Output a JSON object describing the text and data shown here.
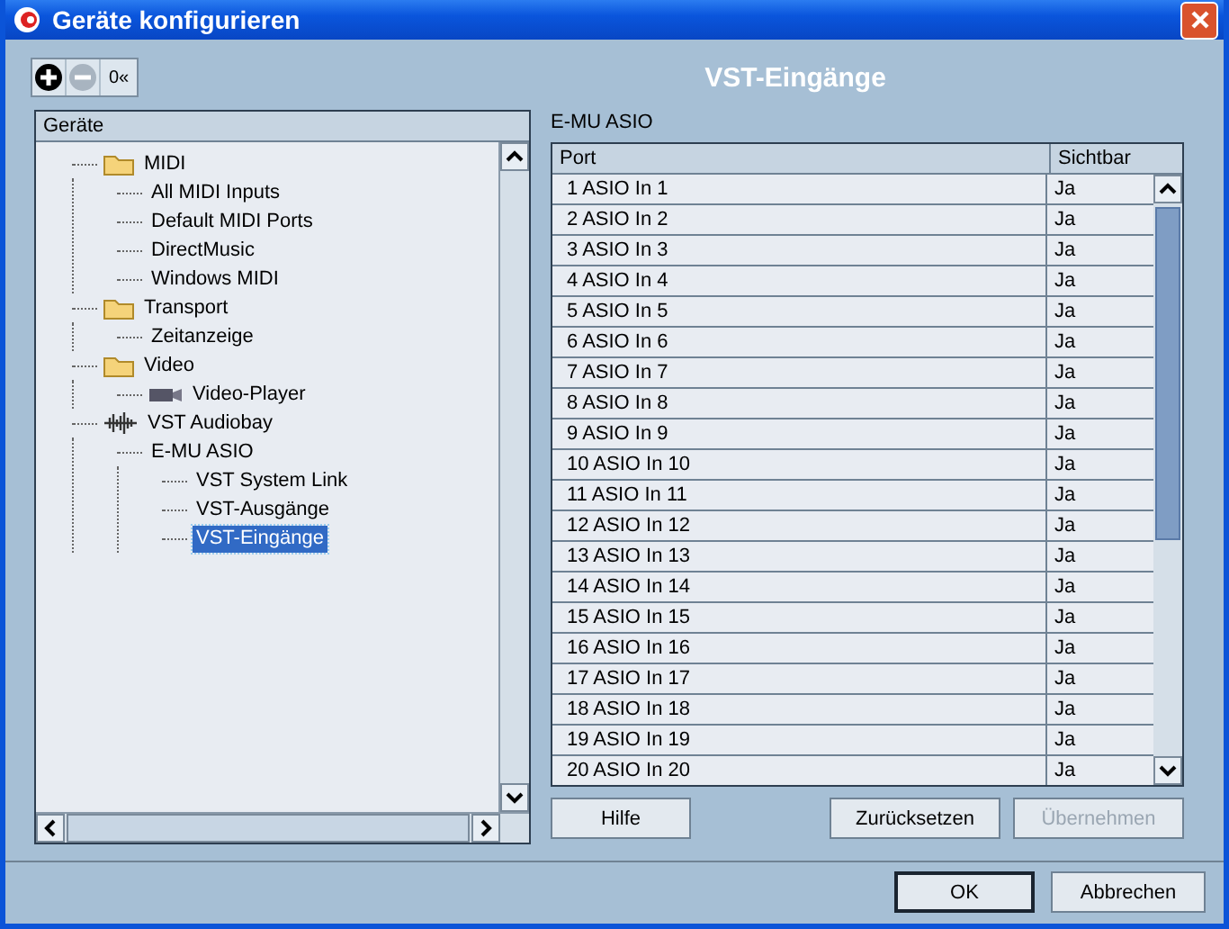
{
  "window": {
    "title": "Geräte konfigurieren"
  },
  "toolbar": [
    {
      "kind": "add",
      "disabled": false
    },
    {
      "kind": "remove",
      "disabled": true
    },
    {
      "kind": "text",
      "label": "0«",
      "disabled": false
    }
  ],
  "heading": "VST-Eingänge",
  "tree": {
    "header": "Geräte",
    "items": [
      {
        "label": "MIDI",
        "kind": "folder",
        "selected": false,
        "children": [
          {
            "label": "All MIDI Inputs",
            "selected": false
          },
          {
            "label": "Default MIDI Ports",
            "selected": false
          },
          {
            "label": "DirectMusic",
            "selected": false
          },
          {
            "label": "Windows MIDI",
            "selected": false
          }
        ]
      },
      {
        "label": "Transport",
        "kind": "folder",
        "selected": false,
        "children": [
          {
            "label": "Zeitanzeige",
            "selected": false
          }
        ]
      },
      {
        "label": "Video",
        "kind": "folder",
        "selected": false,
        "children": [
          {
            "label": "Video-Player",
            "kind": "video",
            "selected": false
          }
        ]
      },
      {
        "label": "VST Audiobay",
        "kind": "audio",
        "selected": false,
        "children": [
          {
            "label": "E-MU ASIO",
            "selected": false,
            "children": [
              {
                "label": "VST System Link",
                "selected": false
              },
              {
                "label": "VST-Ausgänge",
                "selected": false
              },
              {
                "label": "VST-Eingänge",
                "selected": true
              }
            ]
          }
        ]
      }
    ]
  },
  "device_label": "E-MU ASIO",
  "table": {
    "columns": [
      "Port",
      "Sichtbar"
    ],
    "rows": [
      [
        "1 ASIO In 1",
        "Ja"
      ],
      [
        "2 ASIO In 2",
        "Ja"
      ],
      [
        "3 ASIO In 3",
        "Ja"
      ],
      [
        "4 ASIO In 4",
        "Ja"
      ],
      [
        "5 ASIO In 5",
        "Ja"
      ],
      [
        "6 ASIO In 6",
        "Ja"
      ],
      [
        "7 ASIO In 7",
        "Ja"
      ],
      [
        "8 ASIO In 8",
        "Ja"
      ],
      [
        "9 ASIO In 9",
        "Ja"
      ],
      [
        "10 ASIO In 10",
        "Ja"
      ],
      [
        "11 ASIO In 11",
        "Ja"
      ],
      [
        "12 ASIO In 12",
        "Ja"
      ],
      [
        "13 ASIO In 13",
        "Ja"
      ],
      [
        "14 ASIO In 14",
        "Ja"
      ],
      [
        "15 ASIO In 15",
        "Ja"
      ],
      [
        "16 ASIO In 16",
        "Ja"
      ],
      [
        "17 ASIO In 17",
        "Ja"
      ],
      [
        "18 ASIO In 18",
        "Ja"
      ],
      [
        "19 ASIO In 19",
        "Ja"
      ],
      [
        "20 ASIO In 20",
        "Ja"
      ]
    ]
  },
  "panel_buttons": [
    {
      "label": "Hilfe",
      "disabled": false
    },
    {
      "label": "Zurücksetzen",
      "disabled": false
    },
    {
      "label": "Übernehmen",
      "disabled": true
    }
  ],
  "dialog_buttons": [
    {
      "label": "OK",
      "default": true
    },
    {
      "label": "Abbrechen",
      "default": false
    }
  ]
}
